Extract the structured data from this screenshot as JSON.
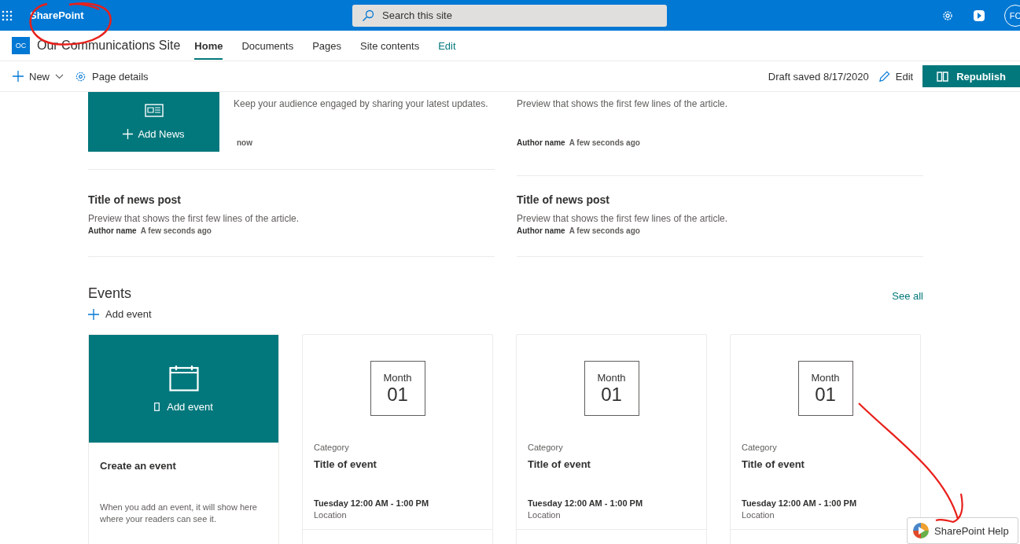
{
  "app_bar": {
    "brand": "SharePoint",
    "search": {
      "placeholder": "Search this site"
    },
    "avatar": "FC"
  },
  "site_header": {
    "logo": "OC",
    "title": "Our Communications Site",
    "nav": [
      {
        "label": "Home",
        "kind": "tab",
        "selected": true
      },
      {
        "label": "Documents",
        "kind": "tab",
        "selected": false
      },
      {
        "label": "Pages",
        "kind": "tab",
        "selected": false
      },
      {
        "label": "Site contents",
        "kind": "tab",
        "selected": false
      },
      {
        "label": "Edit",
        "kind": "link"
      }
    ]
  },
  "command_bar": {
    "new": "New",
    "page_details": "Page details",
    "status": "Draft saved 8/17/2020",
    "edit": "Edit",
    "republish": "Republish"
  },
  "news": {
    "add_news": "Add News",
    "intro": "Keep your audience engaged by sharing your latest updates.",
    "intro_time": "now",
    "items": [
      {
        "preview": "Preview that shows the first few lines of the article.",
        "author": "Author name",
        "time": "A few seconds ago"
      },
      {
        "title": "Title of news post",
        "preview": "Preview that shows the first few lines of the article.",
        "author": "Author name",
        "time": "A few seconds ago"
      },
      {
        "title": "Title of news post",
        "preview": "Preview that shows the first few lines of the article.",
        "author": "Author name",
        "time": "A few seconds ago"
      }
    ]
  },
  "events": {
    "title": "Events",
    "add_event": "Add event",
    "see_all": "See all",
    "create_card": {
      "button": "Add event",
      "title": "Create an event",
      "description": "When you add an event, it will show here where your readers can see it."
    },
    "items": [
      {
        "month": "Month",
        "day": "01",
        "category": "Category",
        "title": "Title of event",
        "time": "Tuesday 12:00 AM - 1:00 PM",
        "location": "Location"
      },
      {
        "month": "Month",
        "day": "01",
        "category": "Category",
        "title": "Title of event",
        "time": "Tuesday 12:00 AM - 1:00 PM",
        "location": "Location"
      },
      {
        "month": "Month",
        "day": "01",
        "category": "Category",
        "title": "Title of event",
        "time": "Tuesday 12:00 AM - 1:00 PM",
        "location": "Location"
      }
    ]
  },
  "help": {
    "label": "SharePoint Help"
  }
}
